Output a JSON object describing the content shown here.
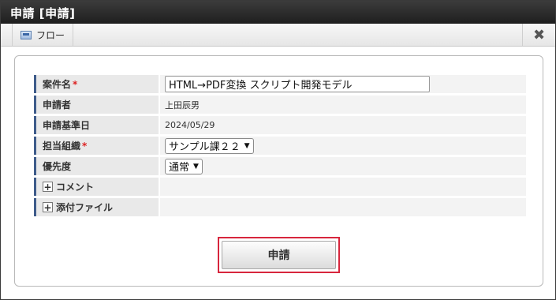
{
  "window": {
    "title": "申請  [申請]"
  },
  "toolbar": {
    "flow_label": "フロー",
    "close_glyph": "✖"
  },
  "form": {
    "fields": [
      {
        "label": "案件名",
        "required": "*",
        "value": "HTML→PDF変換 スクリプト開発モデル"
      },
      {
        "label": "申請者",
        "value": "上田辰男"
      },
      {
        "label": "申請基準日",
        "value": "2024/05/29"
      },
      {
        "label": "担当組織",
        "required": "*",
        "selected": "サンプル課２２"
      },
      {
        "label": "優先度",
        "selected": "通常"
      },
      {
        "label": "コメント",
        "expander": "+"
      },
      {
        "label": "添付ファイル",
        "expander": "+"
      }
    ]
  },
  "actions": {
    "submit_label": "申請"
  },
  "colors": {
    "accent_border": "#3e5b8a",
    "highlight": "#d7263d",
    "required": "#dd2222",
    "titlebar": "#2a2a2a"
  }
}
